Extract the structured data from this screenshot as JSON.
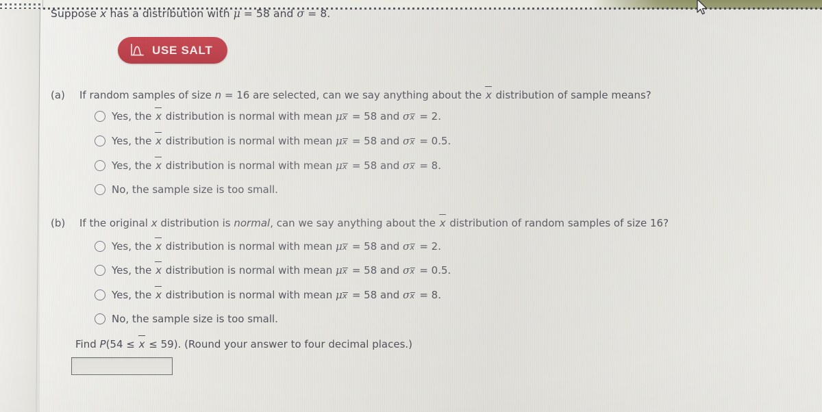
{
  "problem": {
    "stem_prefix": "Suppose ",
    "stem_var": "x",
    "stem_mid": " has a distribution with ",
    "stem_mu": "μ",
    "stem_mu_val": " = 58 and ",
    "stem_sigma": "σ",
    "stem_sigma_val": " = 8."
  },
  "salt_button": {
    "label": "USE SALT",
    "icon": "normal-curve-icon",
    "color": "#bb3a45",
    "text_color": "#f6eae9"
  },
  "parts": [
    {
      "label": "(a)",
      "question": {
        "t1": "If random samples of size ",
        "n": "n",
        "t2": " = 16 are selected, can we say anything about the ",
        "xbar": "x",
        "t3": " distribution of sample means?"
      },
      "options": [
        {
          "id": "a1",
          "selected": false,
          "t1": "Yes, the ",
          "xbar": "x",
          "t2": " distribution is normal with mean ",
          "mu": "μ",
          "t3": " = 58 and ",
          "sigma": "σ",
          "t4": " = 2."
        },
        {
          "id": "a2",
          "selected": false,
          "t1": "Yes, the ",
          "xbar": "x",
          "t2": " distribution is normal with mean ",
          "mu": "μ",
          "t3": " = 58 and ",
          "sigma": "σ",
          "t4": " = 0.5."
        },
        {
          "id": "a3",
          "selected": false,
          "t1": "Yes, the ",
          "xbar": "x",
          "t2": " distribution is normal with mean ",
          "mu": "μ",
          "t3": " = 58 and ",
          "sigma": "σ",
          "t4": " = 8."
        },
        {
          "id": "a4",
          "selected": false,
          "plain": "No, the sample size is too small."
        }
      ]
    },
    {
      "label": "(b)",
      "question": {
        "t1": "If the original ",
        "n": "x",
        "t2": " distribution is ",
        "em": "normal",
        "t2b": ", can we say anything about the ",
        "xbar": "x",
        "t3": " distribution of random samples of size 16?"
      },
      "options": [
        {
          "id": "b1",
          "selected": false,
          "t1": "Yes, the ",
          "xbar": "x",
          "t2": " distribution is normal with mean ",
          "mu": "μ",
          "t3": " = 58 and ",
          "sigma": "σ",
          "t4": " = 2."
        },
        {
          "id": "b2",
          "selected": false,
          "t1": "Yes, the ",
          "xbar": "x",
          "t2": " distribution is normal with mean ",
          "mu": "μ",
          "t3": " = 58 and ",
          "sigma": "σ",
          "t4": " = 0.5."
        },
        {
          "id": "b3",
          "selected": false,
          "t1": "Yes, the ",
          "xbar": "x",
          "t2": " distribution is normal with mean ",
          "mu": "μ",
          "t3": " = 58 and ",
          "sigma": "σ",
          "t4": " = 8."
        },
        {
          "id": "b4",
          "selected": false,
          "plain": "No, the sample size is too small."
        }
      ]
    }
  ],
  "find": {
    "t1": "Find ",
    "p": "P",
    "t2": "(54 ≤ ",
    "xbar": "x",
    "t3": " ≤ 59). (Round your answer to four decimal places.)",
    "answer_value": "",
    "answer_placeholder": ""
  }
}
